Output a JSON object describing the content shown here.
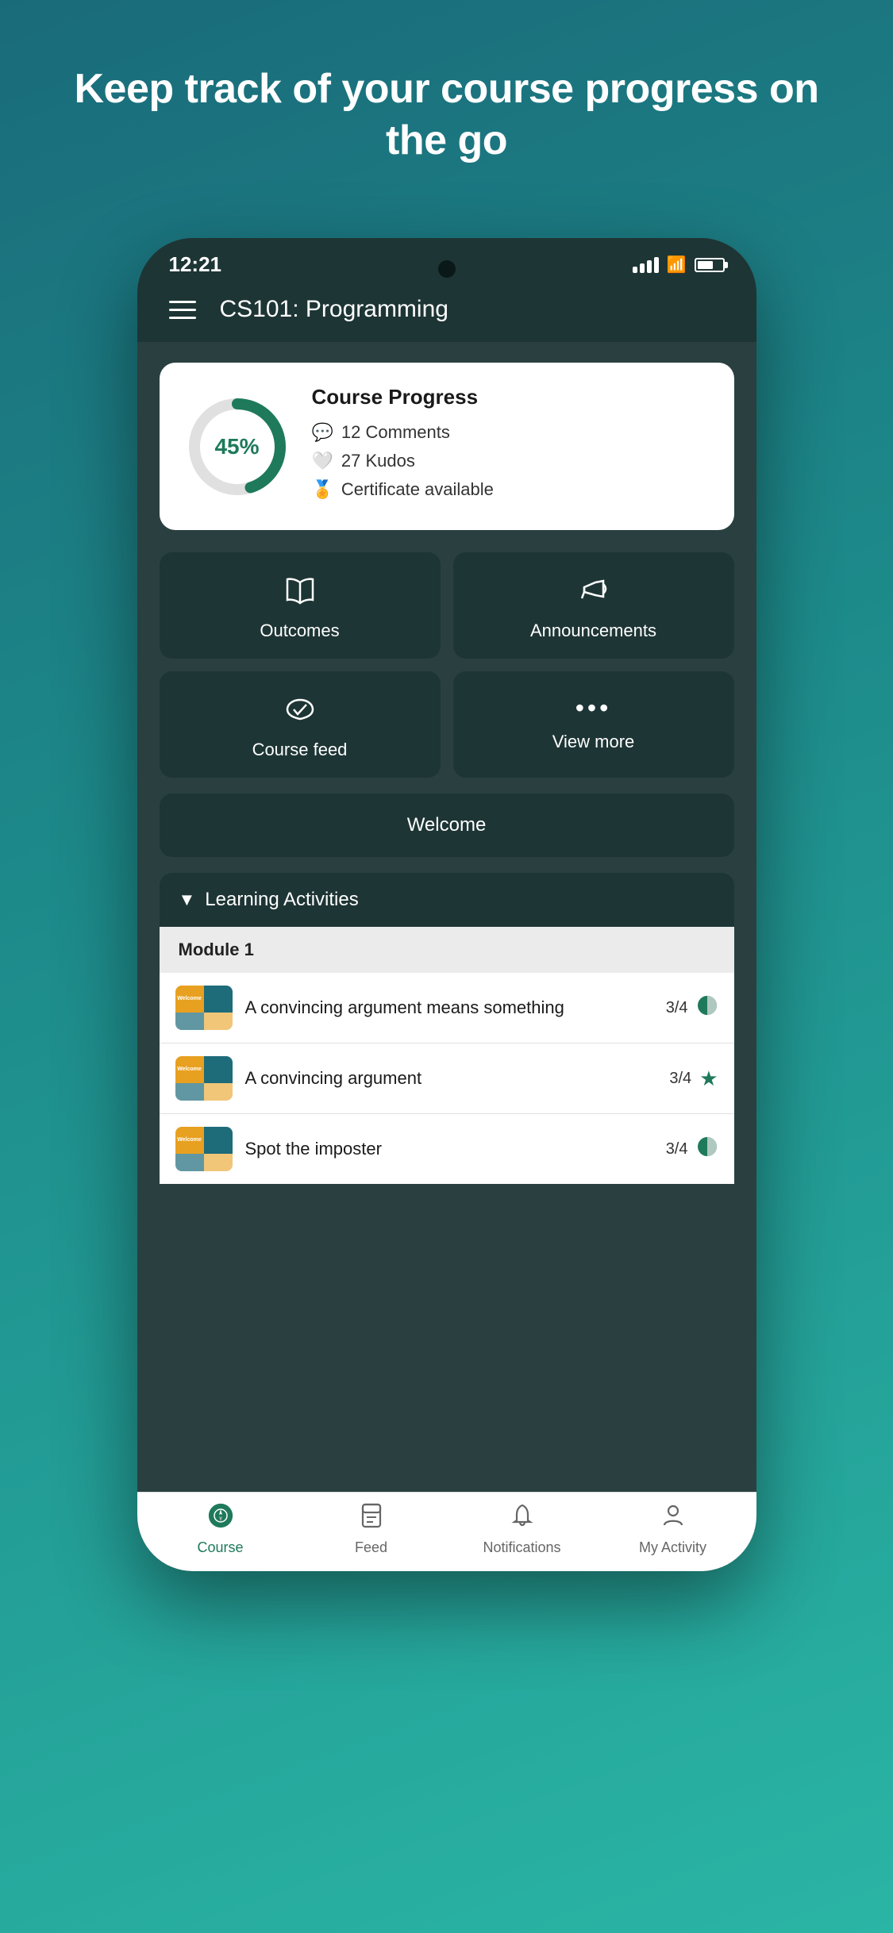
{
  "hero": {
    "title": "Keep track of your course progress on the go"
  },
  "status_bar": {
    "time": "12:21",
    "signal": "4 bars",
    "wifi": "on",
    "battery": "65%"
  },
  "app_header": {
    "title": "CS101: Programming"
  },
  "progress_card": {
    "title": "Course Progress",
    "percentage": "45%",
    "percent_value": 45,
    "stats": [
      {
        "icon": "💬",
        "label": "12 Comments"
      },
      {
        "icon": "🤍",
        "label": "27 Kudos"
      },
      {
        "icon": "🏅",
        "label": "Certificate available"
      }
    ]
  },
  "quick_actions": [
    {
      "id": "outcomes",
      "icon": "📖",
      "label": "Outcomes"
    },
    {
      "id": "announcements",
      "icon": "📢",
      "label": "Announcements"
    },
    {
      "id": "course-feed",
      "icon": "💗",
      "label": "Course feed"
    },
    {
      "id": "view-more",
      "icon": "•••",
      "label": "View more"
    }
  ],
  "welcome_button": {
    "label": "Welcome"
  },
  "learning_activities": {
    "header_label": "Learning Activities",
    "chevron": "▼",
    "module_label": "Module 1",
    "items": [
      {
        "title": "A convincing argument means something",
        "score": "3/4",
        "status": "partial",
        "status_icon": "🟢"
      },
      {
        "title": "A convincing argument",
        "score": "3/4",
        "status": "star",
        "status_icon": "⭐"
      },
      {
        "title": "Spot the imposter",
        "score": "3/4",
        "status": "partial",
        "status_icon": "🟢"
      }
    ]
  },
  "bottom_nav": [
    {
      "id": "course",
      "icon": "🧭",
      "label": "Course",
      "active": true
    },
    {
      "id": "feed",
      "icon": "🫙",
      "label": "Feed",
      "active": false
    },
    {
      "id": "notifications",
      "icon": "🔔",
      "label": "Notifications",
      "active": false
    },
    {
      "id": "my-activity",
      "icon": "👤",
      "label": "My Activity",
      "active": false
    }
  ]
}
